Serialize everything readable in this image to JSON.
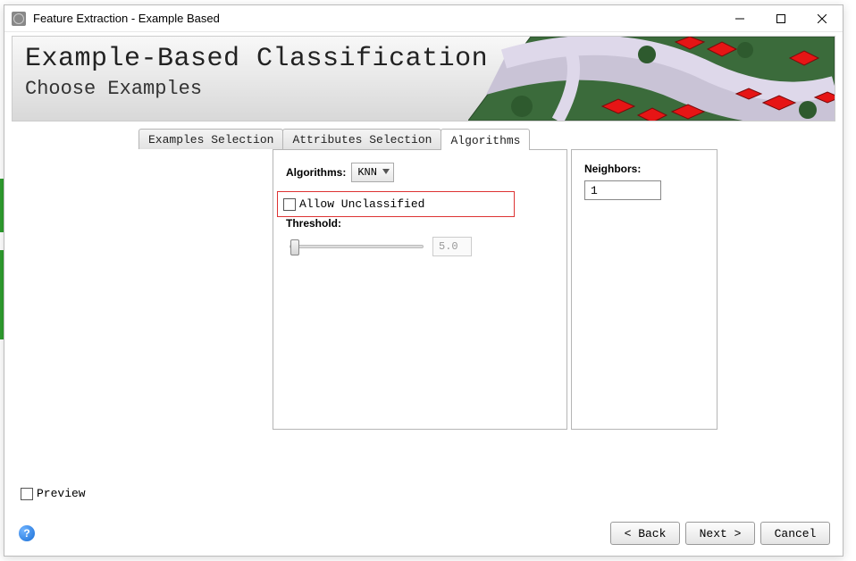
{
  "window": {
    "title": "Feature Extraction - Example Based"
  },
  "banner": {
    "title": "Example-Based Classification",
    "subtitle": "Choose Examples"
  },
  "tabs": {
    "examples": "Examples Selection",
    "attributes": "Attributes Selection",
    "algorithms": "Algorithms"
  },
  "left_panel": {
    "algorithms_label": "Algorithms:",
    "algorithm_selected": "KNN",
    "allow_unclassified_label": "Allow Unclassified",
    "allow_unclassified_checked": false,
    "threshold_label": "Threshold:",
    "threshold_value": "5.0"
  },
  "right_panel": {
    "neighbors_label": "Neighbors:",
    "neighbors_value": "1"
  },
  "footer": {
    "preview_label": "Preview",
    "preview_checked": false,
    "back_label": "< Back",
    "next_label": "Next >",
    "cancel_label": "Cancel"
  }
}
